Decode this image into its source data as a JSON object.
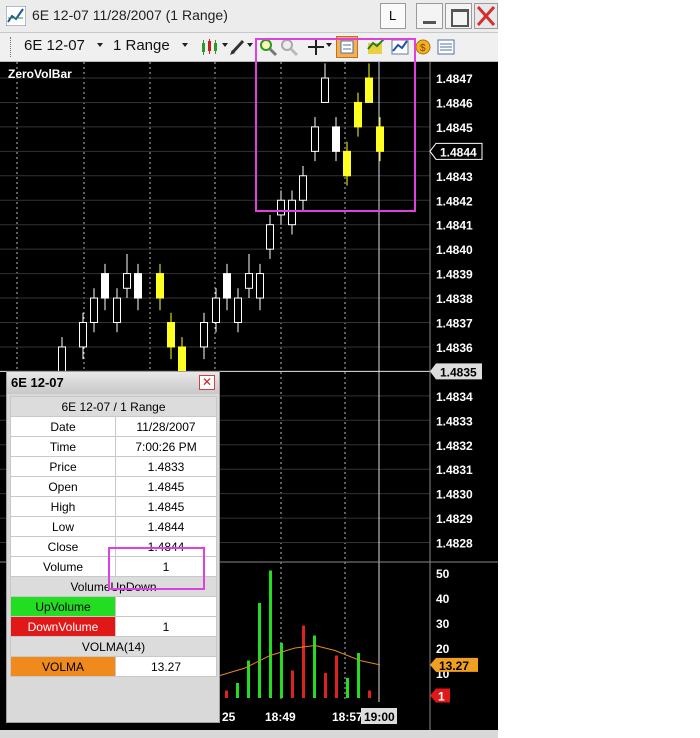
{
  "window": {
    "title": "6E 12-07  11/28/2007 (1 Range)",
    "l_button": "L"
  },
  "toolbar": {
    "instrument": "6E 12-07",
    "period": "1 Range"
  },
  "chart": {
    "indicator_label": "ZeroVolBar",
    "price_labels": [
      "1.4847",
      "1.4846",
      "1.4845",
      "1.4844",
      "1.4843",
      "1.4842",
      "1.4841",
      "1.4840",
      "1.4839",
      "1.4838",
      "1.4837",
      "1.4836",
      "1.4835",
      "1.4834",
      "1.4833",
      "1.4832",
      "1.4831",
      "1.4830",
      "1.4829",
      "1.4828"
    ],
    "current_price": "1.4844",
    "crosshair_price": "1.4835",
    "volume_labels": [
      "50",
      "40",
      "30",
      "20",
      "10"
    ],
    "volma_value": "13.27",
    "volume_value": "1",
    "time_labels": [
      "18:49",
      "18:57",
      "19:00"
    ],
    "time_fragment": "25",
    "colors": {
      "background": "#000000",
      "up_bar": "#ffffff",
      "zero_vol_bar": "#ffff22",
      "volume_up": "#22dd22",
      "volume_down": "#dd2222",
      "volma_line": "#e08a20"
    }
  },
  "databox": {
    "title": "6E 12-07",
    "header": "6E 12-07 / 1 Range",
    "rows": [
      {
        "label": "Date",
        "value": "11/28/2007"
      },
      {
        "label": "Time",
        "value": "7:00:26 PM"
      },
      {
        "label": "Price",
        "value": "1.4833"
      },
      {
        "label": "Open",
        "value": "1.4845"
      },
      {
        "label": "High",
        "value": "1.4845"
      },
      {
        "label": "Low",
        "value": "1.4844"
      },
      {
        "label": "Close",
        "value": "1.4844"
      },
      {
        "label": "Volume",
        "value": "1"
      }
    ],
    "volume_updown_header": "VolumeUpDown",
    "up_volume": {
      "label": "UpVolume",
      "value": ""
    },
    "down_volume": {
      "label": "DownVolume",
      "value": "1"
    },
    "volma_header": "VOLMA(14)",
    "volma": {
      "label": "VOLMA",
      "value": "13.27"
    }
  }
}
